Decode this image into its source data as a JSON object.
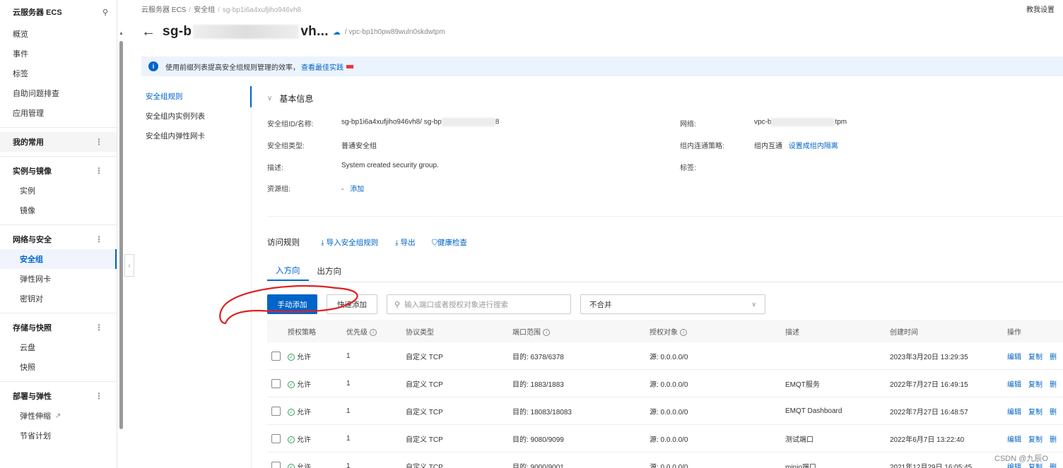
{
  "sidebar": {
    "title": "云服务器 ECS",
    "items_top": [
      "概览",
      "事件",
      "标签",
      "自助问题排查",
      "应用管理"
    ],
    "my_common": "我的常用",
    "groups": [
      {
        "label": "实例与镜像",
        "items": [
          "实例",
          "镜像"
        ]
      },
      {
        "label": "网络与安全",
        "items": [
          "安全组",
          "弹性网卡",
          "密钥对"
        ]
      },
      {
        "label": "存储与快照",
        "items": [
          "云盘",
          "快照"
        ]
      },
      {
        "label": "部署与弹性",
        "items": [
          "弹性伸缩",
          "节省计划"
        ]
      }
    ]
  },
  "breadcrumb": {
    "root": "云服务器 ECS",
    "mid": "安全组",
    "last": "sg-bp1i6a4xufjiho946vh8"
  },
  "header": {
    "settings": "教我设置",
    "title_start": "sg-b",
    "title_end": "vh...",
    "vpc": "/ vpc-bp1h0pw89wuln0skdwtpm"
  },
  "notice": {
    "text": "使用前缀列表提高安全组规则管理的效率，",
    "link": "查看最佳实践"
  },
  "subnav": [
    "安全组规则",
    "安全组内实例列表",
    "安全组内弹性网卡"
  ],
  "basic": {
    "title": "基本信息",
    "id_label": "安全组ID/名称:",
    "id_value": "sg-bp1i6a4xufjiho946vh8/ sg-bp",
    "id_tail": "8",
    "type_label": "安全组类型:",
    "type_value": "普通安全组",
    "desc_label": "描述:",
    "desc_value": "System created security group.",
    "rg_label": "资源组:",
    "rg_dash": "-",
    "rg_add": "添加",
    "net_label": "网络:",
    "net_value_start": "vpc-b",
    "net_value_end": "tpm",
    "policy_label": "组内连通策略:",
    "policy_value": "组内互通",
    "policy_link": "设置成组内隔离",
    "tag_label": "标签:"
  },
  "rules": {
    "title": "访问规则",
    "import": "导入安全组规则",
    "export": "导出",
    "health": "健康检查",
    "tab_in": "入方向",
    "tab_out": "出方向",
    "btn_manual": "手动添加",
    "btn_quick": "快速添加",
    "search_placeholder": "输入端口或者授权对象进行搜索",
    "merge_select": "不合并"
  },
  "table": {
    "headers": [
      "授权策略",
      "优先级",
      "协议类型",
      "端口范围",
      "授权对象",
      "描述",
      "创建时间",
      "操作"
    ],
    "rows": [
      {
        "policy": "允许",
        "priority": "1",
        "protocol": "自定义 TCP",
        "port": "目的: 6378/6378",
        "source": "源: 0.0.0.0/0",
        "desc": "",
        "time": "2023年3月20日 13:29:35"
      },
      {
        "policy": "允许",
        "priority": "1",
        "protocol": "自定义 TCP",
        "port": "目的: 1883/1883",
        "source": "源: 0.0.0.0/0",
        "desc": "EMQT服务",
        "time": "2022年7月27日 16:49:15"
      },
      {
        "policy": "允许",
        "priority": "1",
        "protocol": "自定义 TCP",
        "port": "目的: 18083/18083",
        "source": "源: 0.0.0.0/0",
        "desc": "EMQT Dashboard",
        "time": "2022年7月27日 16:48:57"
      },
      {
        "policy": "允许",
        "priority": "1",
        "protocol": "自定义 TCP",
        "port": "目的: 9080/9099",
        "source": "源: 0.0.0.0/0",
        "desc": "测试端口",
        "time": "2022年6月7日 13:22:40"
      },
      {
        "policy": "允许",
        "priority": "1",
        "protocol": "自定义 TCP",
        "port": "目的: 9000/9001",
        "source": "源: 0.0.0.0/0",
        "desc": "minio端口",
        "time": "2021年12月29日 16:05:45"
      }
    ],
    "op_edit": "编辑",
    "op_copy": "复制",
    "op_delete": "删"
  },
  "watermark": "CSDN @九辰O",
  "colors": {
    "accent": "#0064c8",
    "annotation": "#e02020"
  }
}
